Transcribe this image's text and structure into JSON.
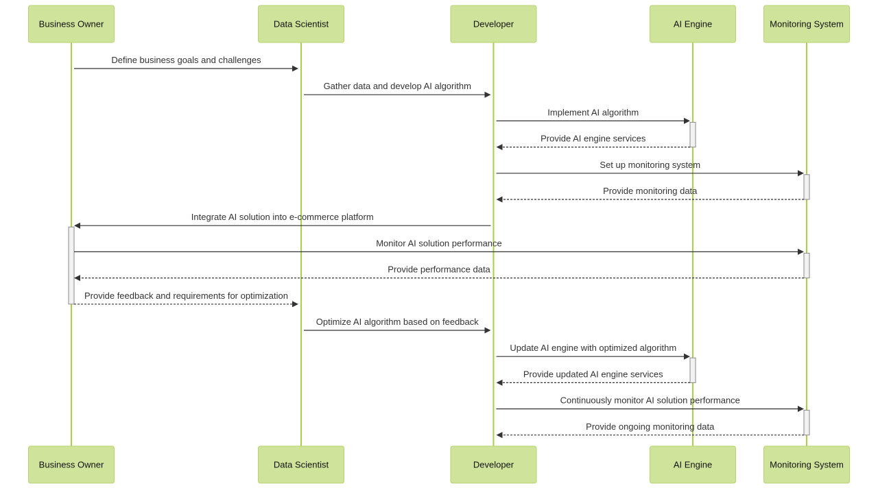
{
  "diagram": {
    "type": "sequence",
    "participants": [
      {
        "id": "bo",
        "label": "Business Owner"
      },
      {
        "id": "ds",
        "label": "Data Scientist"
      },
      {
        "id": "dev",
        "label": "Developer"
      },
      {
        "id": "ai",
        "label": "AI Engine"
      },
      {
        "id": "mon",
        "label": "Monitoring System"
      }
    ],
    "messages": [
      {
        "from": "bo",
        "to": "ds",
        "label": "Define business goals and challenges",
        "style": "solid"
      },
      {
        "from": "ds",
        "to": "dev",
        "label": "Gather data and develop AI algorithm",
        "style": "solid"
      },
      {
        "from": "dev",
        "to": "ai",
        "label": "Implement AI algorithm",
        "style": "solid",
        "activate": true
      },
      {
        "from": "ai",
        "to": "dev",
        "label": "Provide AI engine services",
        "style": "dashed",
        "deactivate": true
      },
      {
        "from": "dev",
        "to": "mon",
        "label": "Set up monitoring system",
        "style": "solid",
        "activate": true
      },
      {
        "from": "mon",
        "to": "dev",
        "label": "Provide monitoring data",
        "style": "dashed",
        "deactivate": true
      },
      {
        "from": "dev",
        "to": "bo",
        "label": "Integrate AI solution into e-commerce platform",
        "style": "solid",
        "activate": true
      },
      {
        "from": "bo",
        "to": "mon",
        "label": "Monitor AI solution performance",
        "style": "solid",
        "activate": true
      },
      {
        "from": "mon",
        "to": "bo",
        "label": "Provide performance data",
        "style": "dashed",
        "deactivate": true
      },
      {
        "from": "bo",
        "to": "ds",
        "label": "Provide feedback and requirements for optimization",
        "style": "dashed",
        "deactivate": true
      },
      {
        "from": "ds",
        "to": "dev",
        "label": "Optimize AI algorithm based on feedback",
        "style": "solid"
      },
      {
        "from": "dev",
        "to": "ai",
        "label": "Update AI engine with optimized algorithm",
        "style": "solid",
        "activate": true
      },
      {
        "from": "ai",
        "to": "dev",
        "label": "Provide updated AI engine services",
        "style": "dashed",
        "deactivate": true
      },
      {
        "from": "dev",
        "to": "mon",
        "label": "Continuously monitor AI solution performance",
        "style": "solid",
        "activate": true
      },
      {
        "from": "mon",
        "to": "dev",
        "label": "Provide ongoing monitoring data",
        "style": "dashed",
        "deactivate": true
      }
    ]
  }
}
